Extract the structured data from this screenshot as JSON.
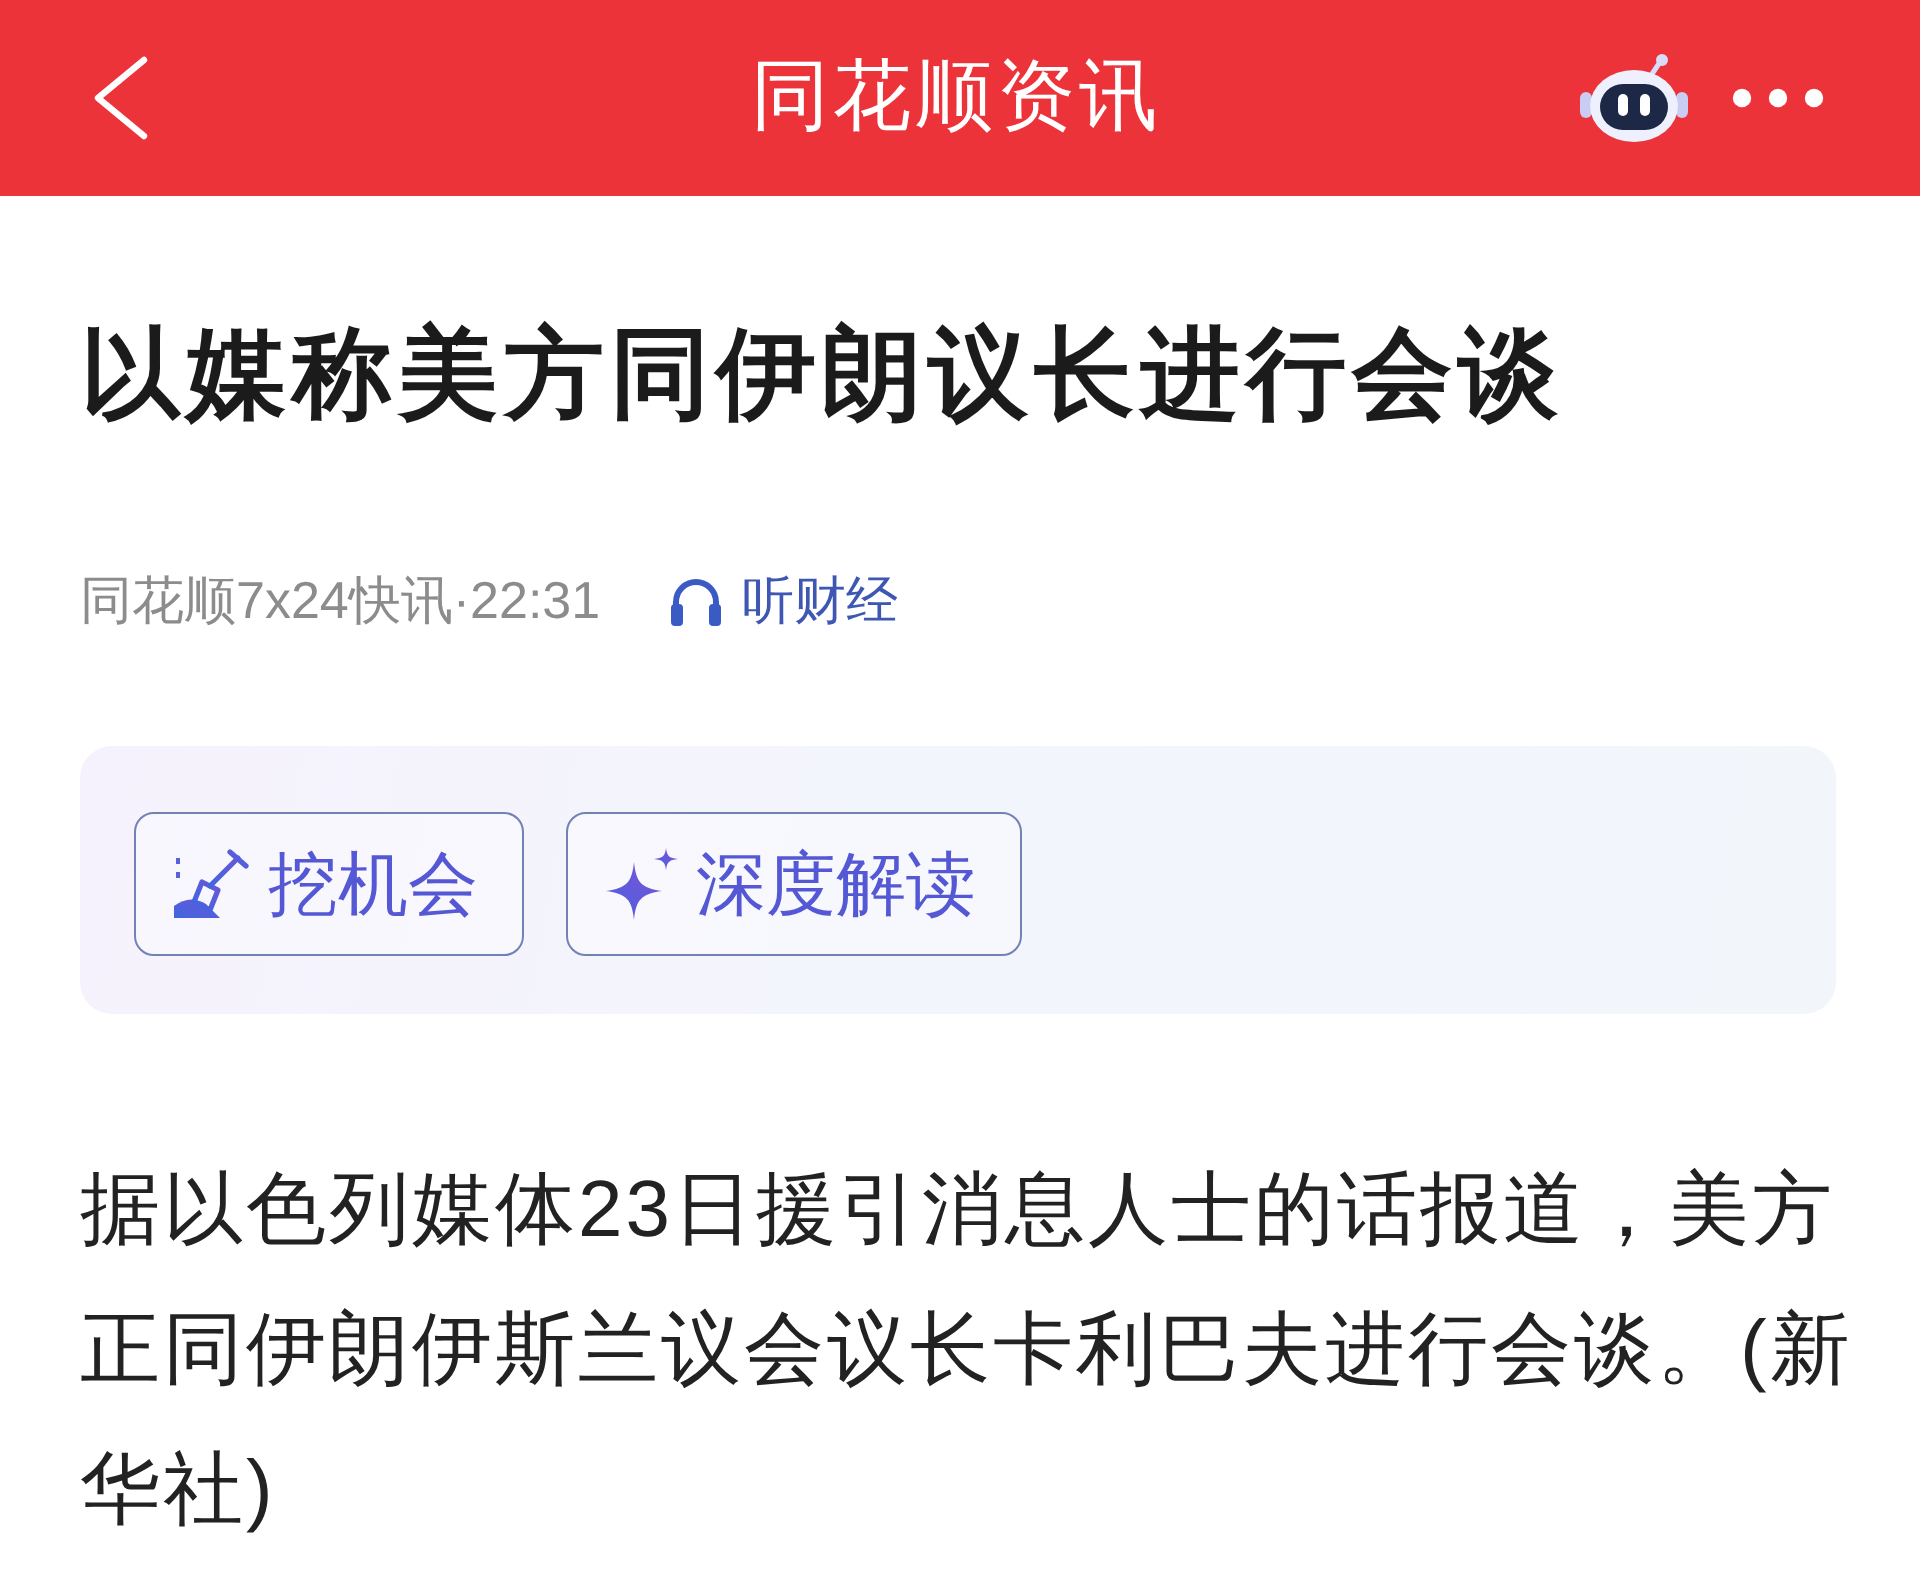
{
  "header": {
    "title": "同花顺资讯"
  },
  "article": {
    "headline": "以媒称美方同伊朗议长进行会谈",
    "source": "同花顺7x24快讯·22:31",
    "listen_label": "听财经",
    "actions": [
      {
        "kind": "dig",
        "label": "挖机会"
      },
      {
        "kind": "sparkle",
        "label": "深度解读"
      }
    ],
    "body": "据以色列媒体23日援引消息人士的话报道，美方正同伊朗伊斯兰议会议长卡利巴夫进行会谈。(新华社)"
  }
}
